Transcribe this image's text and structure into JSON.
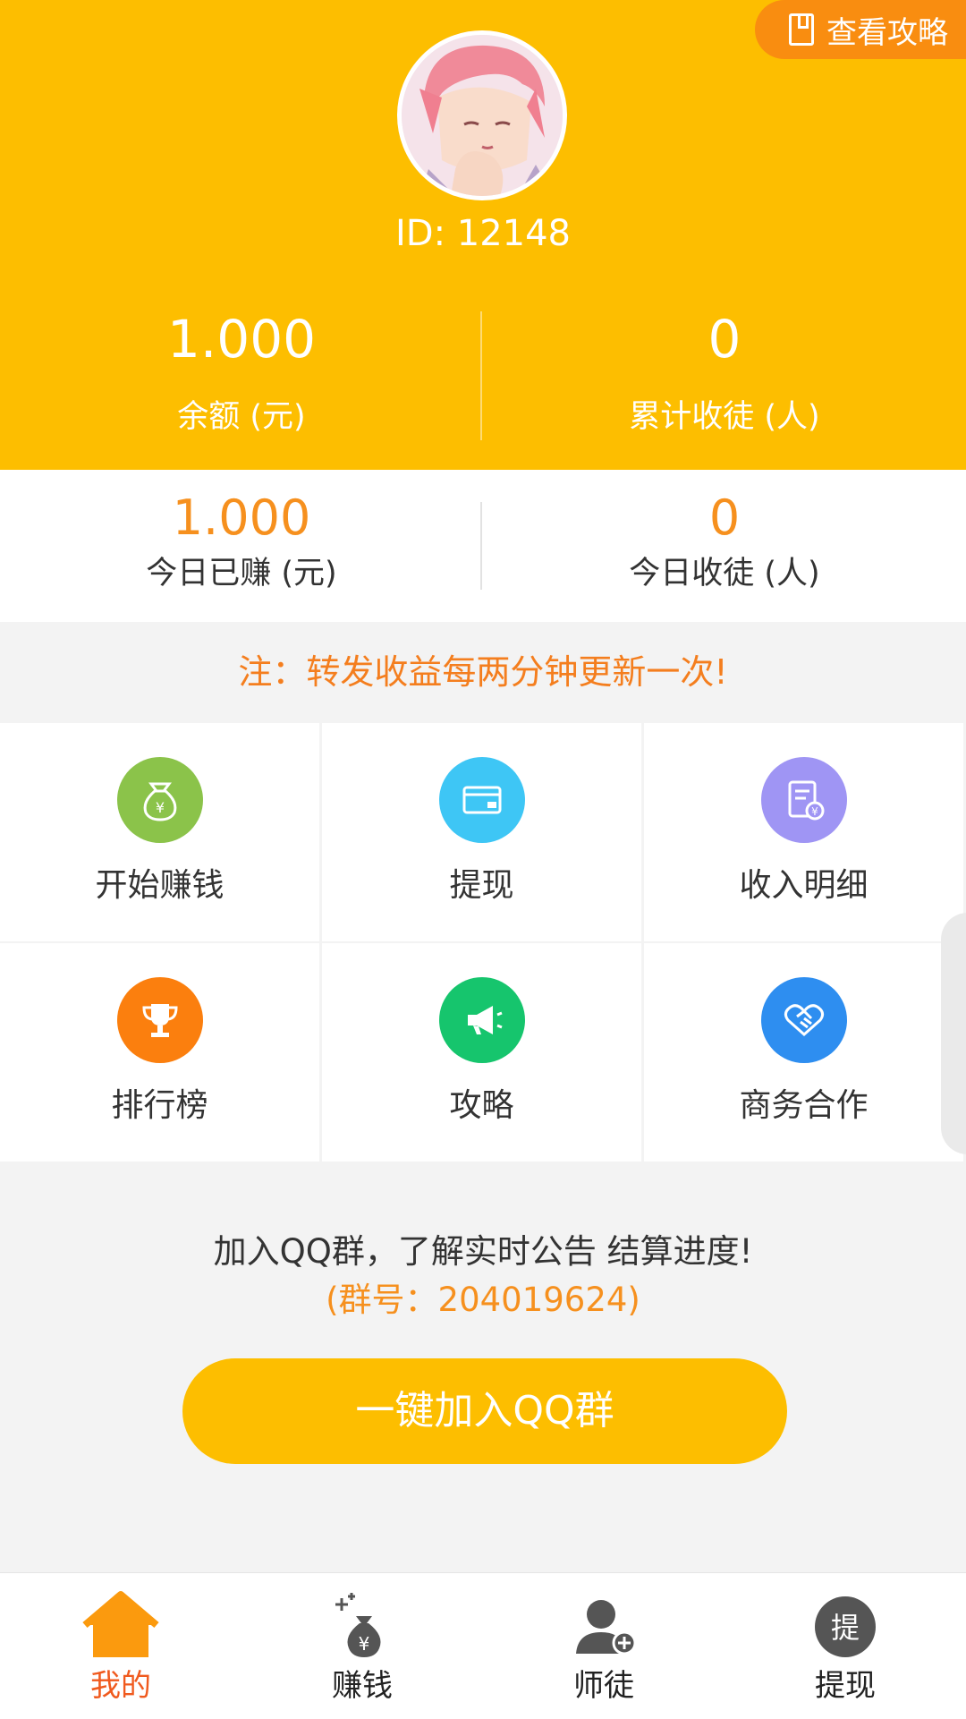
{
  "header": {
    "guide_label": "查看攻略",
    "user_id": "ID: 12148",
    "balance_value": "1.000",
    "balance_label": "余额 (元)",
    "disciples_value": "0",
    "disciples_label": "累计收徒 (人)"
  },
  "today": {
    "earned_value": "1.000",
    "earned_label": "今日已赚 (元)",
    "disciples_value": "0",
    "disciples_label": "今日收徒 (人)"
  },
  "notice": "注：转发收益每两分钟更新一次!",
  "grid": {
    "items": [
      {
        "label": "开始赚钱",
        "icon": "money-bag-icon",
        "color": "#8bc34a"
      },
      {
        "label": "提现",
        "icon": "card-icon",
        "color": "#3ec6f5"
      },
      {
        "label": "收入明细",
        "icon": "bill-icon",
        "color": "#9f95f4"
      },
      {
        "label": "排行榜",
        "icon": "trophy-icon",
        "color": "#fb7f0e"
      },
      {
        "label": "攻略",
        "icon": "megaphone-icon",
        "color": "#16c56d"
      },
      {
        "label": "商务合作",
        "icon": "handshake-icon",
        "color": "#2e8ef0"
      }
    ]
  },
  "qq": {
    "text": "加入QQ群，了解实时公告 结算进度!",
    "group_number": "(群号：204019624)",
    "button_label": "一键加入QQ群"
  },
  "tabbar": {
    "items": [
      {
        "label": "我的",
        "icon": "home-icon",
        "active": true
      },
      {
        "label": "赚钱",
        "icon": "money-bag-sparkle-icon",
        "active": false
      },
      {
        "label": "师徒",
        "icon": "add-user-icon",
        "active": false
      },
      {
        "label": "提现",
        "icon": "withdraw-icon",
        "active": false
      }
    ]
  },
  "colors": {
    "brand": "#fdbe00",
    "accent_orange": "#f6901e",
    "active_tab": "#f05a1e"
  }
}
